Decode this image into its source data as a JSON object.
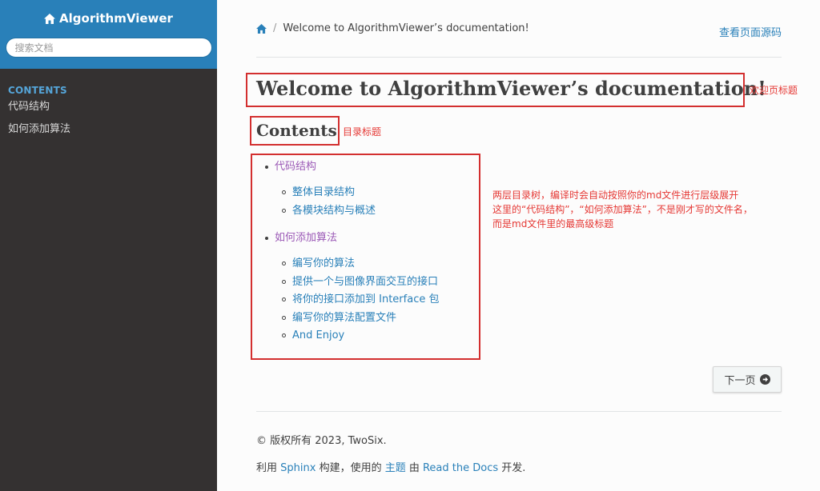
{
  "sidebar": {
    "brand": "AlgorithmViewer",
    "search_placeholder": "搜索文档",
    "caption": "CONTENTS",
    "items": [
      {
        "label": "代码结构"
      },
      {
        "label": "如何添加算法"
      }
    ]
  },
  "breadcrumb": {
    "current": "Welcome to AlgorithmViewer’s documentation!",
    "separator": "/"
  },
  "view_source": "查看页面源码",
  "page": {
    "title": "Welcome to AlgorithmViewer’s documentation!",
    "contents_heading": "Contents"
  },
  "toc": [
    {
      "label": "代码结构",
      "children": [
        "整体目录结构",
        "各模块结构与概述"
      ]
    },
    {
      "label": "如何添加算法",
      "children": [
        "编写你的算法",
        "提供一个与图像界面交互的接口",
        "将你的接口添加到 Interface 包",
        "编写你的算法配置文件",
        "And Enjoy"
      ]
    }
  ],
  "next_button": "下一页",
  "footer": {
    "copyright": "© 版权所有 2023, TwoSix.",
    "built_prefix": "利用 ",
    "sphinx": "Sphinx",
    "built_mid": " 构建，使用的 ",
    "theme": "主题",
    "by": " 由 ",
    "rtd": "Read the Docs",
    "built_suffix": " 开发."
  },
  "annotations": {
    "title_note": "欢迎页标题",
    "contents_note": "目录标题",
    "toc_note_lines": [
      "两层目录树，编译时会自动按照你的md文件进行层级展开",
      "这里的“代码结构”，“如何添加算法”，不是刚才写的文件名，",
      "而是md文件里的最高级标题"
    ]
  },
  "colors": {
    "sidebar_bg": "#343131",
    "sidebar_top": "#2980b9",
    "link": "#2980b9",
    "visited": "#9b59b6",
    "annotation": "#d32f2f"
  }
}
